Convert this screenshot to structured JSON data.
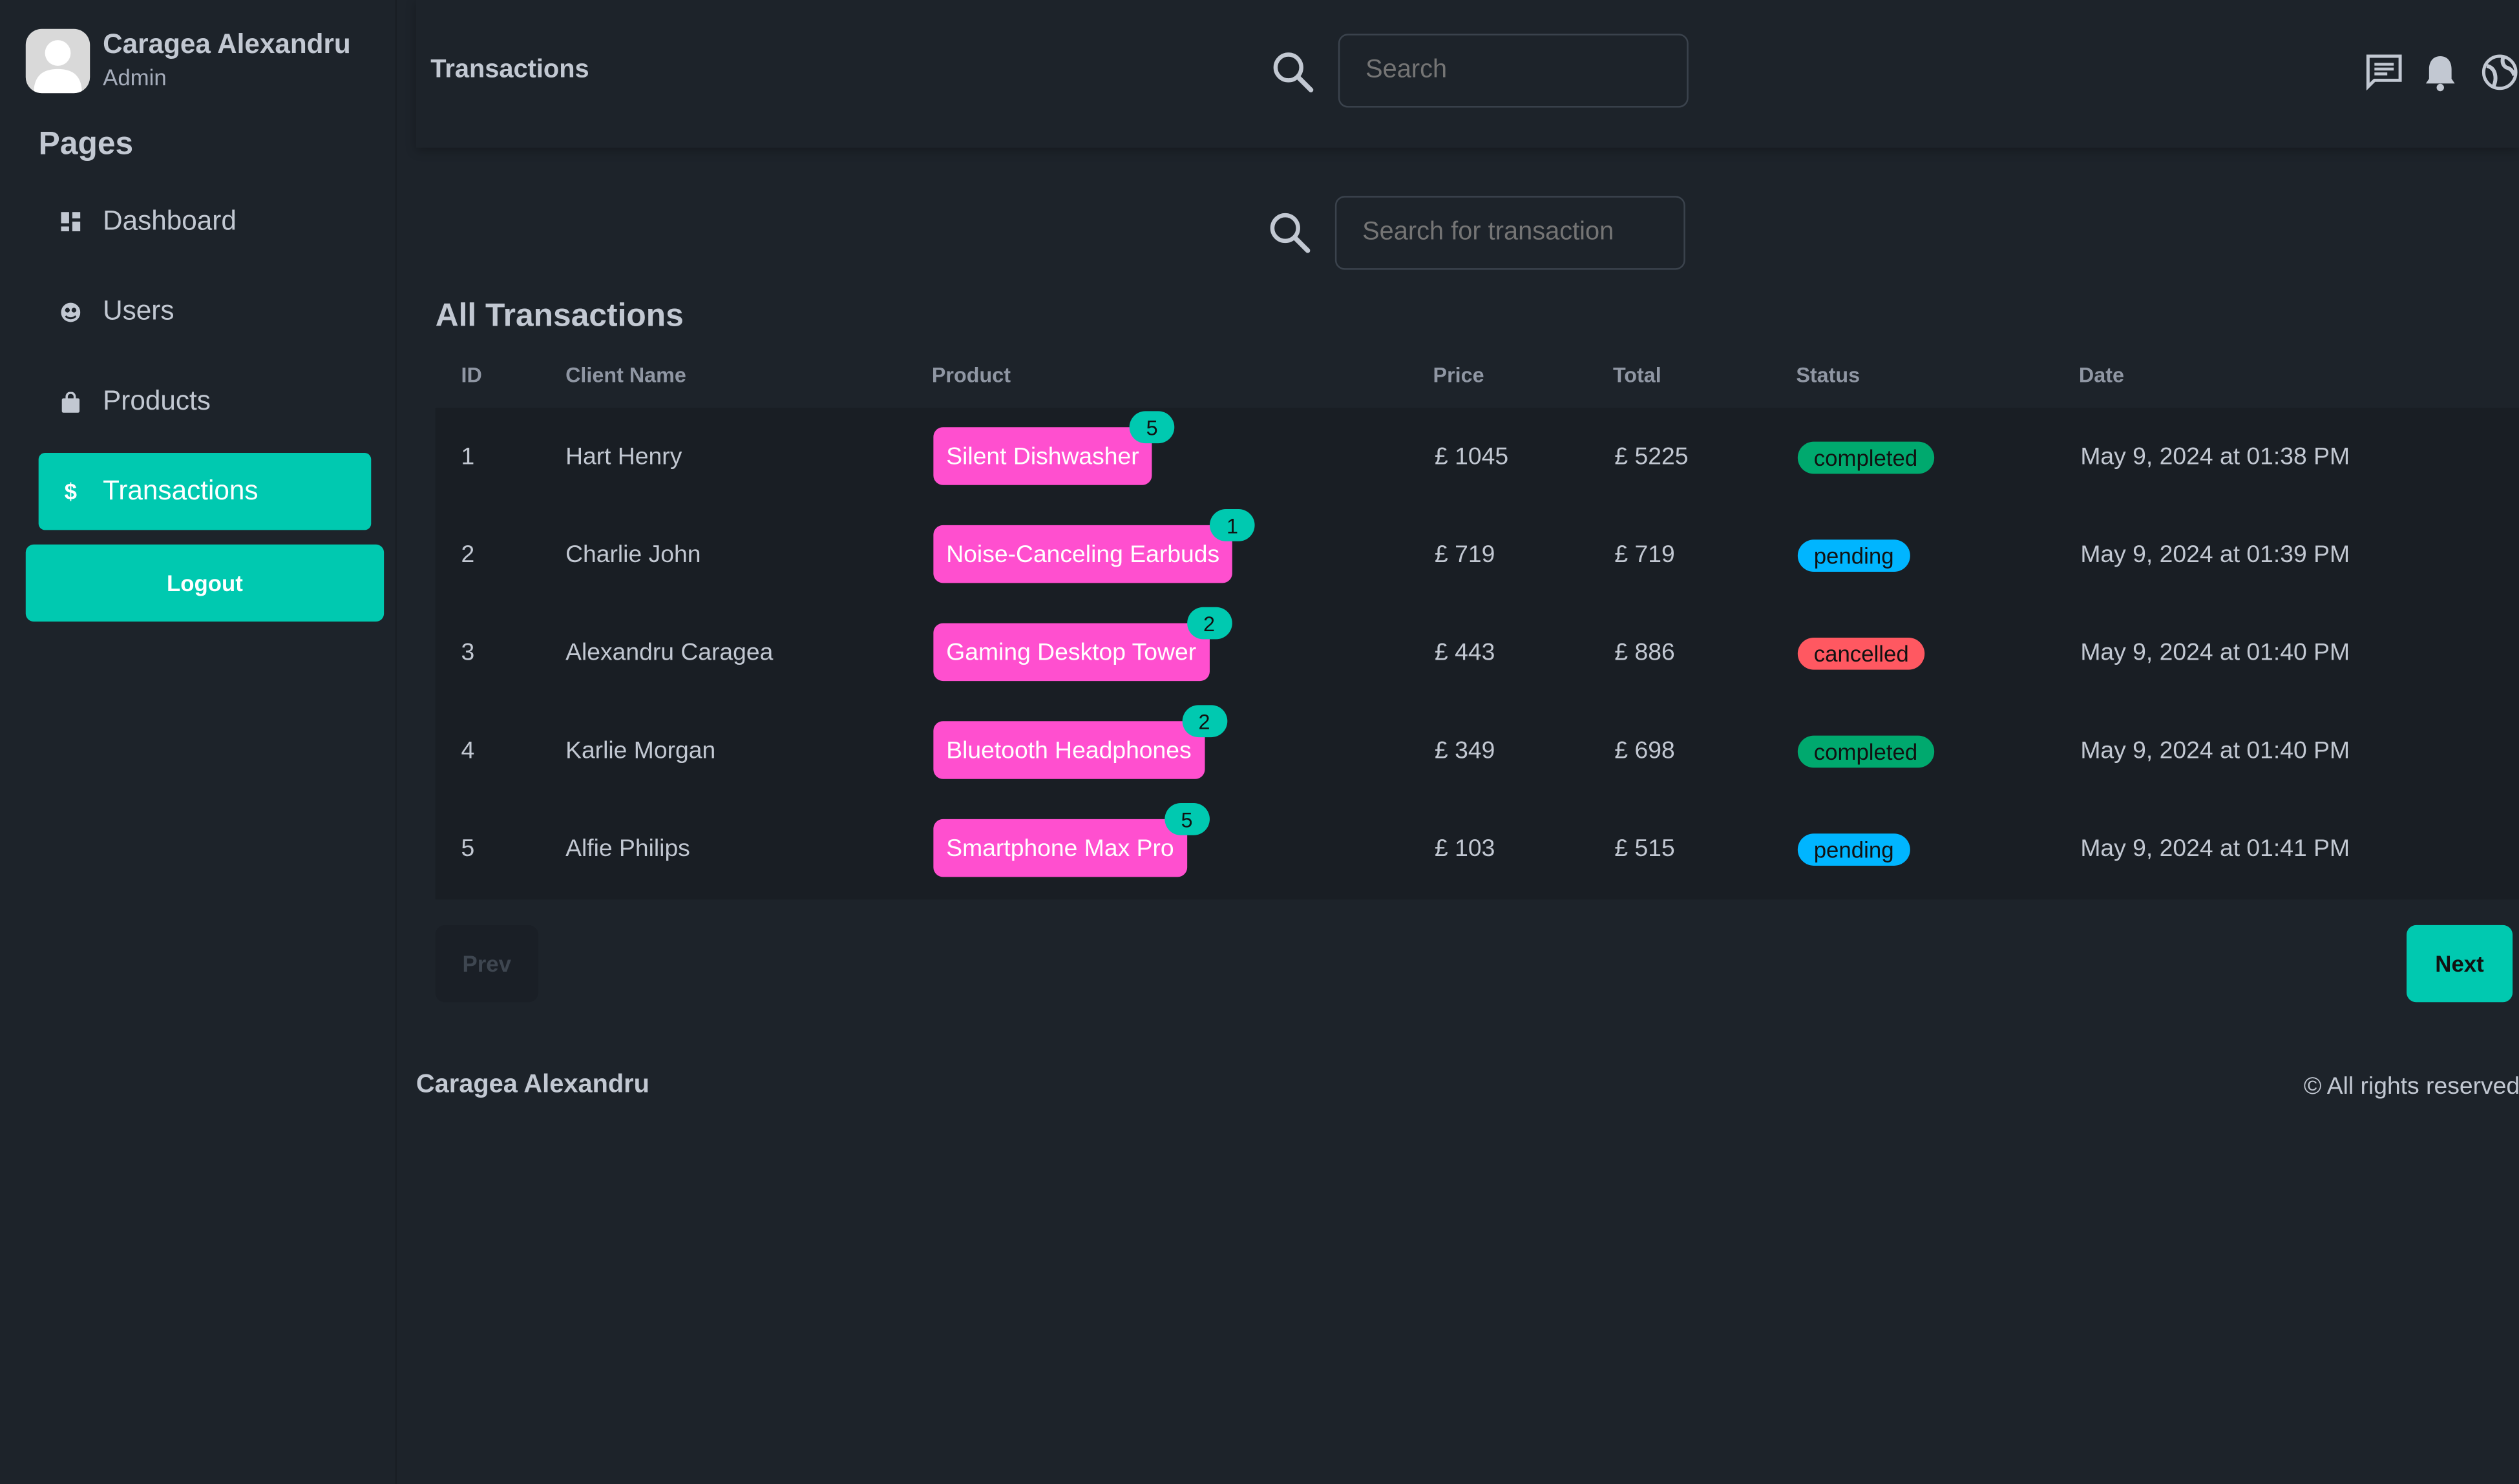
{
  "user": {
    "name": "Caragea Alexandru",
    "role": "Admin"
  },
  "sidebar": {
    "section_title": "Pages",
    "items": [
      {
        "label": "Dashboard",
        "icon": "dashboard-icon",
        "active": false
      },
      {
        "label": "Users",
        "icon": "users-icon",
        "active": false
      },
      {
        "label": "Products",
        "icon": "shopping-bag-icon",
        "active": false
      },
      {
        "label": "Transactions",
        "icon": "dollar-icon",
        "active": true
      }
    ],
    "logout_label": "Logout"
  },
  "header": {
    "title": "Transactions",
    "search_placeholder": "Search",
    "icons": [
      "messages-icon",
      "bell-icon",
      "globe-icon"
    ]
  },
  "transactions": {
    "search_placeholder": "Search for transaction",
    "title": "All Transactions",
    "columns": [
      "ID",
      "Client Name",
      "Product",
      "Price",
      "Total",
      "Status",
      "Date"
    ],
    "rows": [
      {
        "id": "1",
        "client": "Hart Henry",
        "product": "Silent Dishwasher",
        "qty": "5",
        "price": "£ 1045",
        "total": "£ 5225",
        "status": "completed",
        "date": "May 9, 2024 at 01:38 PM"
      },
      {
        "id": "2",
        "client": "Charlie John",
        "product": "Noise-Canceling Earbuds",
        "qty": "1",
        "price": "£ 719",
        "total": "£ 719",
        "status": "pending",
        "date": "May 9, 2024 at 01:39 PM"
      },
      {
        "id": "3",
        "client": "Alexandru Caragea",
        "product": "Gaming Desktop Tower",
        "qty": "2",
        "price": "£ 443",
        "total": "£ 886",
        "status": "cancelled",
        "date": "May 9, 2024 at 01:40 PM"
      },
      {
        "id": "4",
        "client": "Karlie Morgan",
        "product": "Bluetooth Headphones",
        "qty": "2",
        "price": "£ 349",
        "total": "£ 698",
        "status": "completed",
        "date": "May 9, 2024 at 01:40 PM"
      },
      {
        "id": "5",
        "client": "Alfie Philips",
        "product": "Smartphone Max Pro",
        "qty": "5",
        "price": "£ 103",
        "total": "£ 515",
        "status": "pending",
        "date": "May 9, 2024 at 01:41 PM"
      }
    ],
    "status_colors": {
      "completed": "#00a96e",
      "pending": "#00b5ff",
      "cancelled": "#ff5861"
    },
    "prev_label": "Prev",
    "next_label": "Next"
  },
  "footer": {
    "left": "Caragea Alexandru",
    "right": "© All rights reserved"
  },
  "colors": {
    "accent": "#00c9b0",
    "product_badge": "#ff4fcf",
    "background": "#1d232a"
  }
}
